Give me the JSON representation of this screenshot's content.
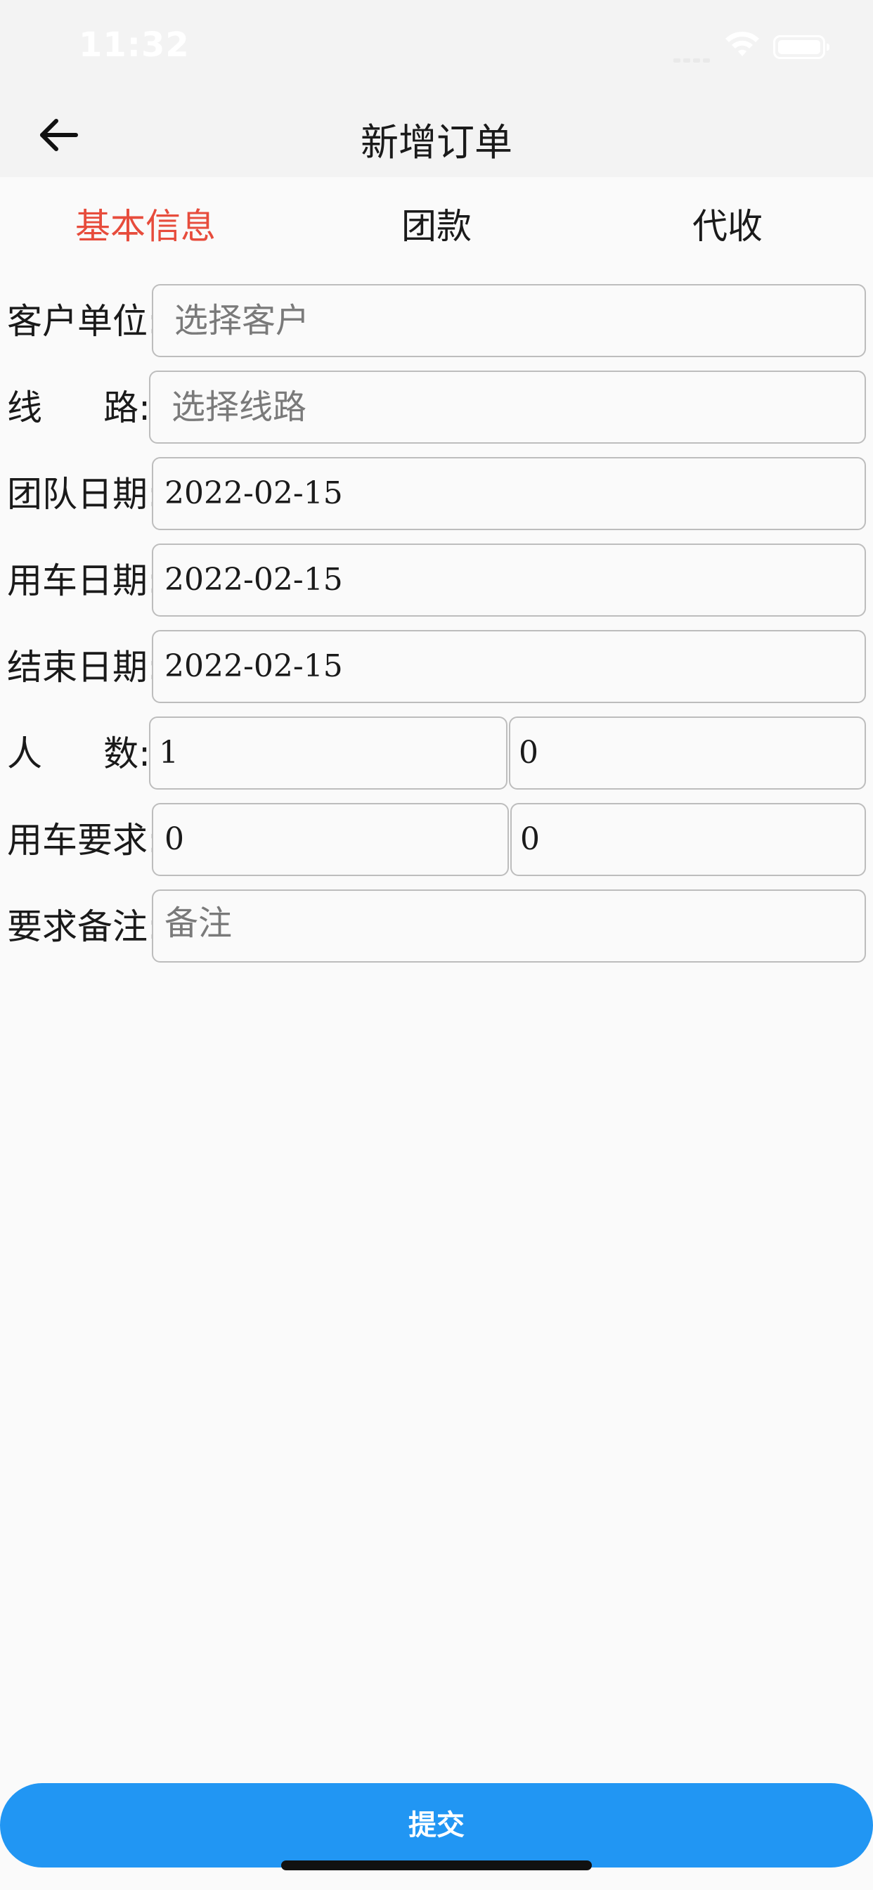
{
  "status_bar": {
    "time": "11:32",
    "wifi_icon": "wifi-icon",
    "battery_icon": "battery-icon"
  },
  "nav": {
    "title": "新增订单",
    "back_icon": "arrow-left-icon"
  },
  "tabs": [
    {
      "label": "基本信息",
      "active": true
    },
    {
      "label": "团款",
      "active": false
    },
    {
      "label": "代收",
      "active": false
    }
  ],
  "form": {
    "customer": {
      "label": "客户单位:",
      "placeholder": "选择客户",
      "value": ""
    },
    "route": {
      "label_left": "线",
      "label_right": "路:",
      "placeholder": "选择线路",
      "value": ""
    },
    "team_date": {
      "label": "团队日期:",
      "value": "2022-02-15"
    },
    "use_date": {
      "label": "用车日期:",
      "value": "2022-02-15"
    },
    "end_date": {
      "label": "结束日期:",
      "value": "2022-02-15"
    },
    "people": {
      "label_left": "人",
      "label_right": "数:",
      "value_1": "1",
      "value_2": "0"
    },
    "vehicle_req": {
      "label": "用车要求:",
      "value_1": "0",
      "value_2": "0"
    },
    "remark": {
      "label": "要求备注:",
      "placeholder": "备注",
      "value": ""
    }
  },
  "submit": {
    "label": "提交"
  },
  "colors": {
    "accent_blue": "#2196f3",
    "active_tab_red": "#e74c3c",
    "bar_bg": "#f3f3f3",
    "page_bg": "#fafafa"
  }
}
